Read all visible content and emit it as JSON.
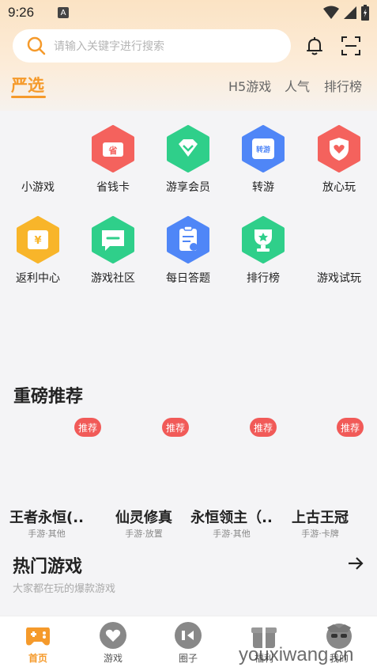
{
  "status": {
    "time": "9:26",
    "a_icon": "A"
  },
  "search": {
    "placeholder": "请输入关键字进行搜索"
  },
  "tabs": {
    "active": "严选",
    "others": [
      "H5游戏",
      "人气",
      "排行榜"
    ]
  },
  "grid": [
    {
      "label": "小游戏",
      "icon": "none",
      "color": ""
    },
    {
      "label": "省钱卡",
      "icon": "wallet-icon",
      "color": "#f4625d"
    },
    {
      "label": "游享会员",
      "icon": "diamond-icon",
      "color": "#2fcf8a"
    },
    {
      "label": "转游",
      "icon": "transfer-icon",
      "color": "#4f86f7"
    },
    {
      "label": "放心玩",
      "icon": "heart-shield-icon",
      "color": "#f4625d"
    },
    {
      "label": "返利中心",
      "icon": "ticket-icon",
      "color": "#f8b52a"
    },
    {
      "label": "游戏社区",
      "icon": "chat-icon",
      "color": "#2fcf8a"
    },
    {
      "label": "每日答题",
      "icon": "clipboard-icon",
      "color": "#4f86f7"
    },
    {
      "label": "排行榜",
      "icon": "trophy-icon",
      "color": "#2fcf8a"
    },
    {
      "label": "游戏试玩",
      "icon": "none",
      "color": ""
    }
  ],
  "recommend": {
    "title": "重磅推荐",
    "badge": "推荐",
    "items": [
      {
        "name": "王者永恒(..",
        "tag": "手游·其他"
      },
      {
        "name": "仙灵修真",
        "tag": "手游·放置"
      },
      {
        "name": "永恒领主（..",
        "tag": "手游·其他"
      },
      {
        "name": "上古王冠",
        "tag": "手游·卡牌"
      }
    ]
  },
  "hot": {
    "title": "热门游戏",
    "subtitle": "大家都在玩的爆款游戏"
  },
  "nav": [
    {
      "label": "首页",
      "icon": "gamepad-icon"
    },
    {
      "label": "游戏",
      "icon": "heart-icon"
    },
    {
      "label": "圈子",
      "icon": "circle-icon"
    },
    {
      "label": "福利",
      "icon": "gift-icon"
    },
    {
      "label": "我的",
      "icon": "profile-icon"
    }
  ],
  "watermark": "youxiwang.cn",
  "colors": {
    "accent": "#f59a2b",
    "badge": "#f15a58"
  }
}
